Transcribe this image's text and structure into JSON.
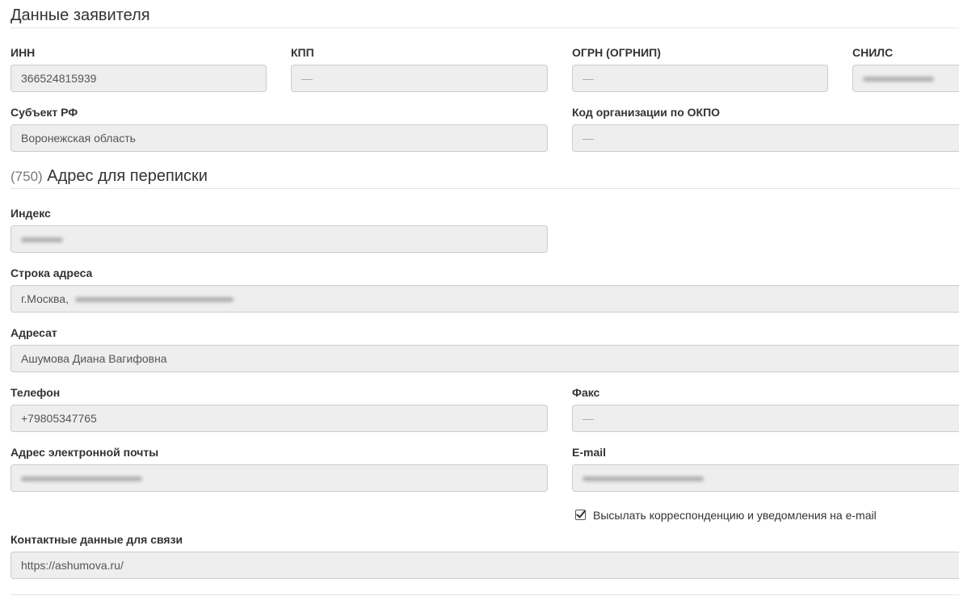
{
  "applicant": {
    "title": "Данные заявителя",
    "inn": {
      "label": "ИНН",
      "value": "366524815939"
    },
    "kpp": {
      "label": "КПП",
      "value": "—"
    },
    "ogrn": {
      "label": "ОГРН (ОГРНИП)",
      "value": "—"
    },
    "snils": {
      "label": "СНИЛС"
    },
    "region": {
      "label": "Субъект РФ",
      "value": "Воронежская область"
    },
    "okpo": {
      "label": "Код организации по ОКПО",
      "value": "—"
    }
  },
  "address": {
    "number": "(750)",
    "title": "Адрес для переписки",
    "index": {
      "label": "Индекс"
    },
    "line": {
      "label": "Строка адреса",
      "value": "г.Москва,"
    },
    "addressee": {
      "label": "Адресат",
      "value": "Ашумова Диана Вагифовна"
    },
    "phone": {
      "label": "Телефон",
      "value": "+79805347765"
    },
    "fax": {
      "label": "Факс",
      "value": "—"
    },
    "email_address": {
      "label": "Адрес электронной почты"
    },
    "email": {
      "label": "E-mail"
    },
    "send_checkbox": {
      "label": "Высылать корреспонденцию и уведомления на e-mail",
      "checked": true
    },
    "contacts": {
      "label": "Контактные данные для связи",
      "value": "https://ashumova.ru/"
    }
  }
}
